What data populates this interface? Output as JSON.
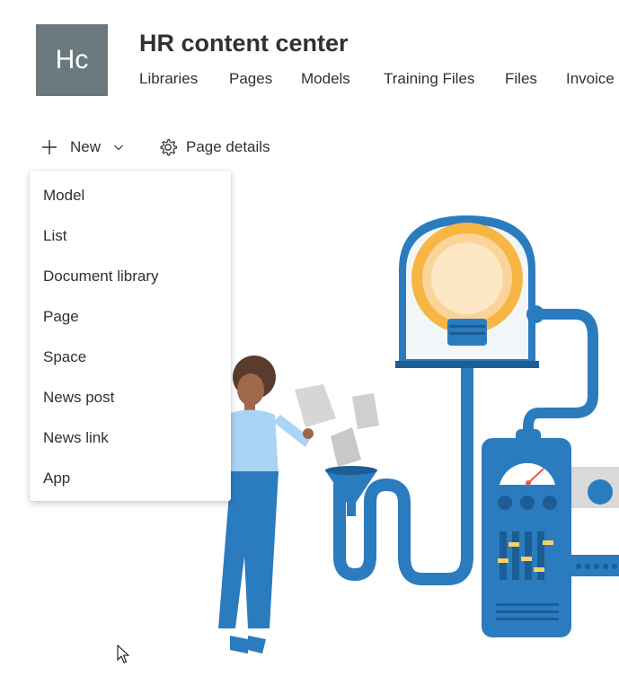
{
  "site": {
    "logo_initials": "Hc",
    "title": "HR content center"
  },
  "nav": {
    "items": [
      "Libraries",
      "Pages",
      "Models",
      "Training Files",
      "Files",
      "Invoice"
    ]
  },
  "command_bar": {
    "new_label": "New",
    "page_details_label": "Page details"
  },
  "new_menu": {
    "items": [
      "Model",
      "List",
      "Document library",
      "Page",
      "Space",
      "News post",
      "News link",
      "App"
    ]
  }
}
